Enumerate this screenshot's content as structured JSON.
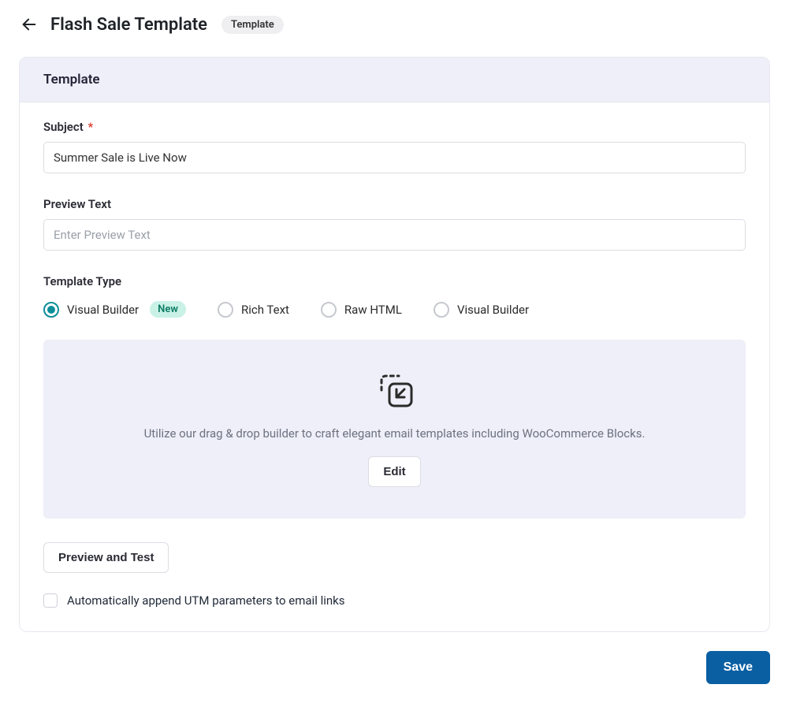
{
  "header": {
    "title": "Flash Sale Template",
    "tag": "Template"
  },
  "card": {
    "heading": "Template"
  },
  "subject": {
    "label": "Subject",
    "required": true,
    "value": "Summer Sale is Live Now"
  },
  "preview_text": {
    "label": "Preview Text",
    "placeholder": "Enter Preview Text",
    "value": ""
  },
  "template_type": {
    "label": "Template Type",
    "options": [
      {
        "id": "visual-builder-new",
        "label": "Visual Builder",
        "badge": "New",
        "selected": true
      },
      {
        "id": "rich-text",
        "label": "Rich Text",
        "selected": false
      },
      {
        "id": "raw-html",
        "label": "Raw HTML",
        "selected": false
      },
      {
        "id": "visual-builder",
        "label": "Visual Builder",
        "selected": false
      }
    ]
  },
  "builder": {
    "description": "Utilize our drag & drop builder to craft elegant email templates including WooCommerce Blocks.",
    "edit_label": "Edit"
  },
  "preview_test_label": "Preview and Test",
  "utm": {
    "checked": false,
    "label": "Automatically append UTM parameters to email links"
  },
  "save_label": "Save"
}
